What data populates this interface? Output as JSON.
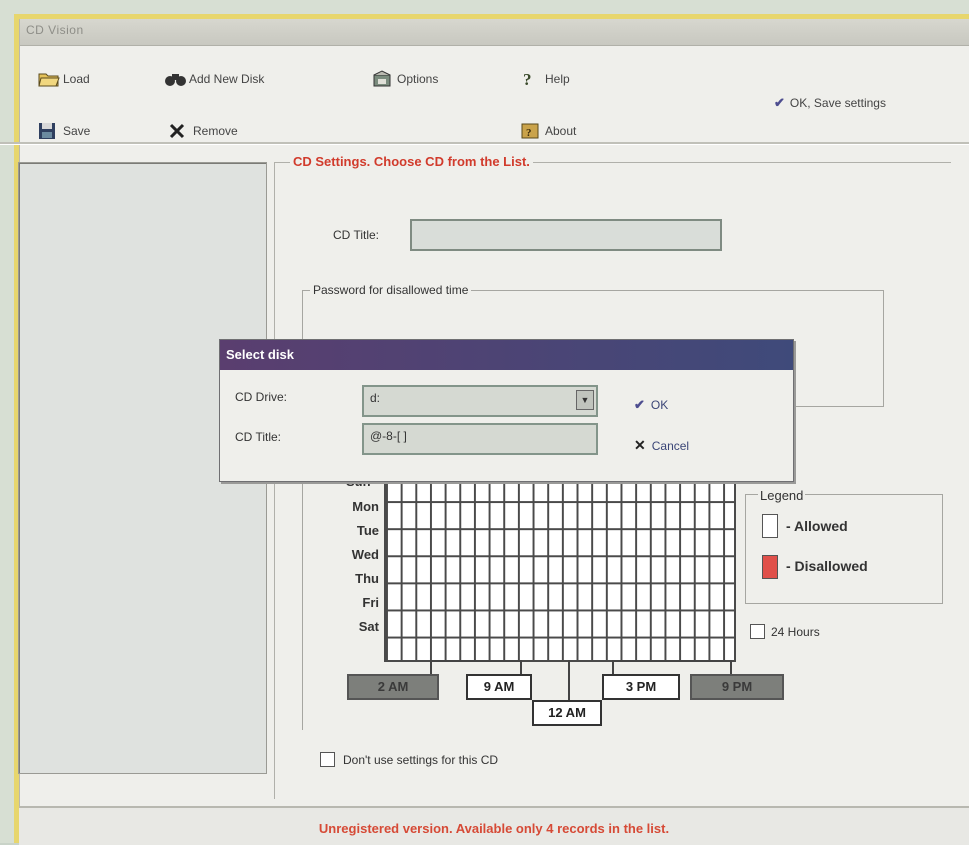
{
  "window": {
    "title": "CD Vision"
  },
  "toolbar": {
    "load": "Load",
    "add_new_disk": "Add New Disk",
    "options": "Options",
    "help": "Help",
    "save": "Save",
    "remove": "Remove",
    "about": "About",
    "ok_save": "OK, Save settings"
  },
  "settings": {
    "title": "CD Settings.  Choose CD from the List.",
    "cd_title_label": "CD Title:",
    "cd_title_value": "",
    "password_group": "Password for disallowed time",
    "dont_use_label": "Don't use settings for this CD"
  },
  "dialog": {
    "title": "Select disk",
    "cd_drive_label": "CD Drive:",
    "cd_drive_value": "d:",
    "cd_title_label": "CD Title:",
    "cd_title_value": "@-8-[ ]",
    "ok": "OK",
    "cancel": "Cancel"
  },
  "schedule": {
    "days": [
      "Mon",
      "Tue",
      "Wed",
      "Thu",
      "Fri",
      "Sat"
    ],
    "partial_day": "Sun",
    "time_buttons": [
      "2 AM",
      "9 AM",
      "12 AM",
      "3 PM",
      "9 PM"
    ],
    "twenty_four_hours": "24 Hours"
  },
  "legend": {
    "title": "Legend",
    "allowed": "- Allowed",
    "disallowed": "- Disallowed",
    "allowed_color": "#ffffff",
    "disallowed_color": "#e0504a"
  },
  "status": "Unregistered version. Available only 4 records in the list."
}
